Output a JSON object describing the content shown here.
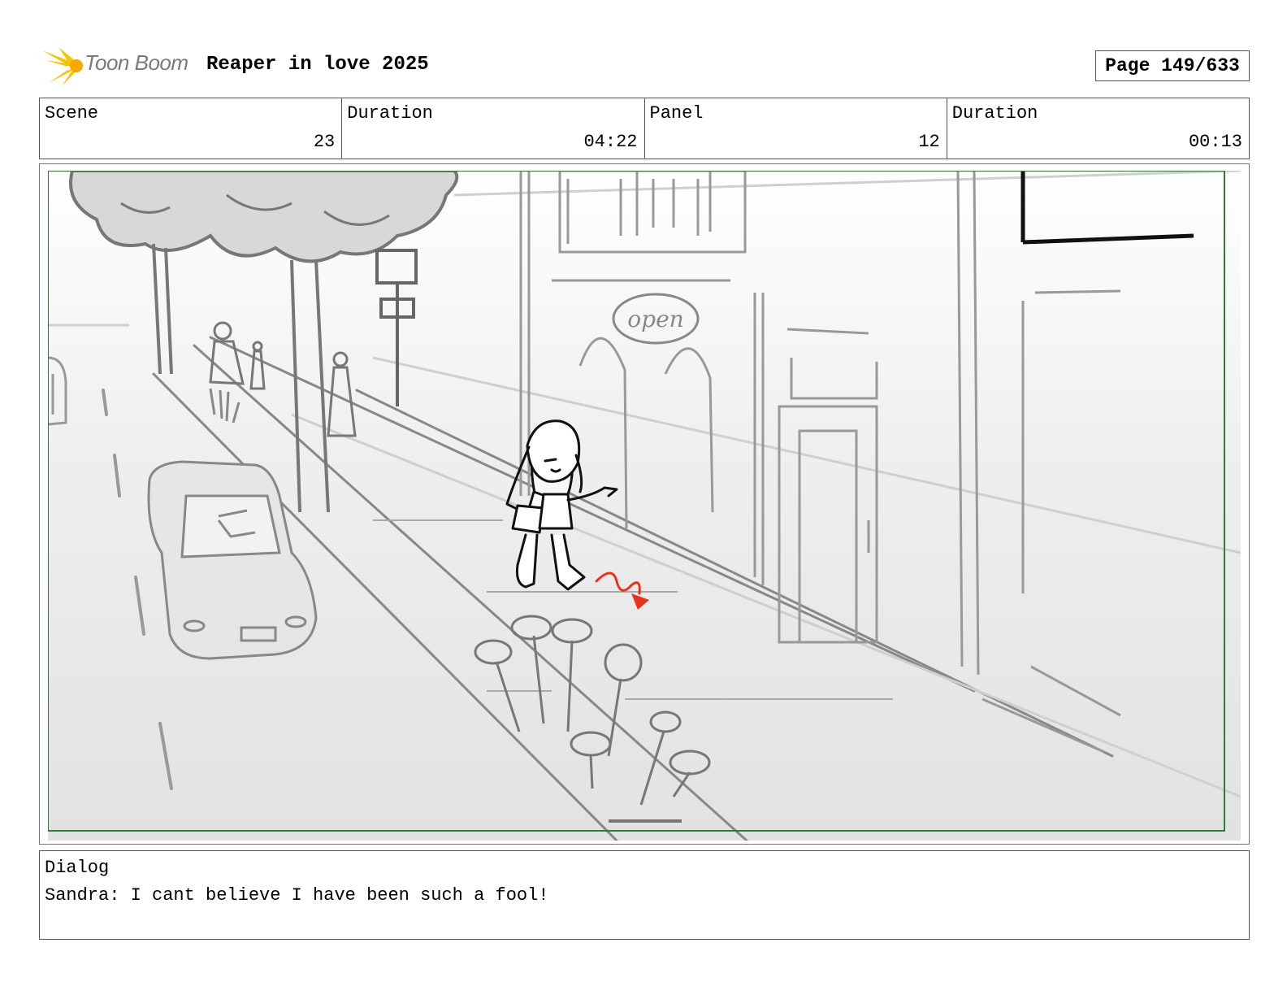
{
  "header": {
    "logo_text": "Toon Boom",
    "project_title": "Reaper in love 2025",
    "page_indicator": "Page 149/633"
  },
  "info": {
    "scene_label": "Scene",
    "scene_value": "23",
    "scene_duration_label": "Duration",
    "scene_duration_value": "04:22",
    "panel_label": "Panel",
    "panel_value": "12",
    "panel_duration_label": "Duration",
    "panel_duration_value": "00:13"
  },
  "panel": {
    "sign_text": "open",
    "frame_color": "#2e7d32",
    "motion_arrow_color": "#e8321e"
  },
  "dialog": {
    "label": "Dialog",
    "text": "Sandra: I cant believe I have been such a fool!"
  }
}
